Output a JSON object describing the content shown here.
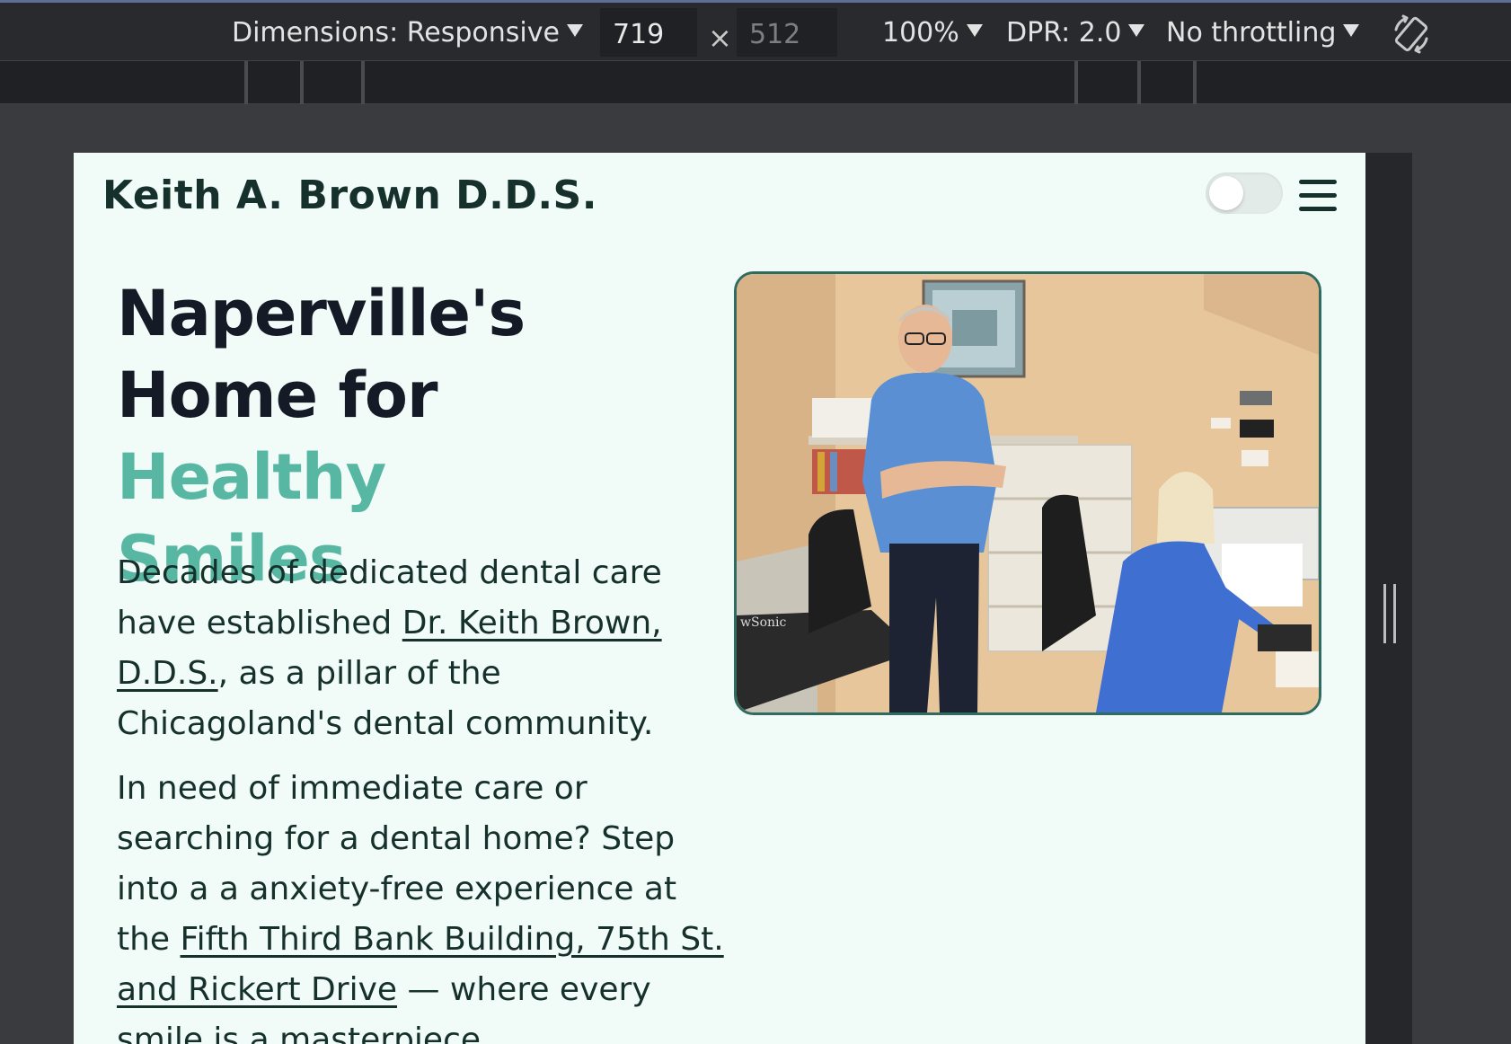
{
  "devtools": {
    "dimensions_label": "Dimensions: Responsive",
    "width_value": "719",
    "times_symbol": "×",
    "height_value": "512",
    "zoom": "100%",
    "dpr": "DPR: 2.0",
    "throttling": "No throttling",
    "icons": [
      "rotate-icon",
      "resize-handle"
    ]
  },
  "site": {
    "brand": "Keith A. Brown D.D.S.",
    "theme_toggle": {
      "state": "off"
    },
    "menu_icon": "hamburger-icon"
  },
  "hero": {
    "title_line1": "Naperville's",
    "title_line2_plain": "Home for ",
    "title_accent_1": "Healthy",
    "title_accent_2": "Smiles",
    "accent_color": "#57b7a3",
    "para1_before": "Decades of dedicated dental care have established ",
    "para1_link": "Dr. Keith Brown, D.D.S.",
    "para1_after": ", as a pillar of the Chicagoland's dental community.",
    "para2_before": "In need of immediate care or searching for a dental home? Step into a a anxiety-free experience at the ",
    "para2_link": "Fifth Third Bank Building, 75th St. and Rickert Drive",
    "para2_after": " — where every smile is a masterpiece.",
    "photo_monitor_text": "wSonic"
  }
}
